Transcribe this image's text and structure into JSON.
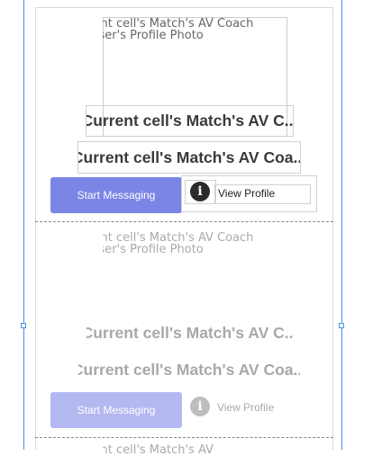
{
  "cells": [
    {
      "photo_alt_line1": "Current cell's Match's AV Coach",
      "photo_alt_line2": "User's Profile Photo",
      "name_line1": "Current cell's Match's AV C...",
      "name_line2": "Current cell's Match's AV Coa...",
      "message_button": "Start Messaging",
      "info_icon_glyph": "i",
      "view_profile": "View Profile"
    },
    {
      "photo_alt_line1": "Current cell's Match's AV Coach",
      "photo_alt_line2": "User's Profile Photo",
      "name_line1": "Current cell's Match's AV C...",
      "name_line2": "Current cell's Match's AV Coa...",
      "message_button": "Start Messaging",
      "info_icon_glyph": "i",
      "view_profile": "View Profile"
    },
    {
      "photo_alt_line1": "Current cell's Match's AV"
    }
  ],
  "colors": {
    "button_primary": "#7b85e6",
    "button_dim": "#b3b8f1",
    "icon_dark": "#2b2b2b",
    "icon_dim": "#bdbdbd",
    "selection": "#4a90e2"
  }
}
